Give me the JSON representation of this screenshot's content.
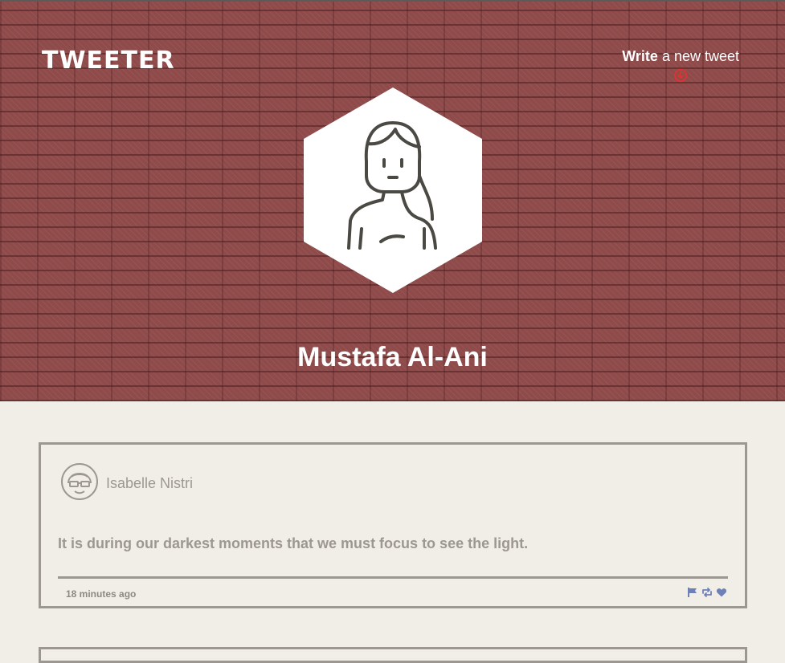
{
  "header": {
    "logo": "TWEETER",
    "compose": {
      "strong": "Write",
      "rest": " a new tweet",
      "icon": "arrow-down-circle-icon",
      "icon_color": "#e0332f"
    },
    "profile": {
      "name": "Mustafa Al-Ani",
      "avatar_icon": "person-avatar-icon"
    },
    "background_color": "#8f4a4a"
  },
  "feed": {
    "tweets": [
      {
        "author": "Isabelle Nistri",
        "avatar_icon": "person-with-glasses-avatar-icon",
        "text": "It is during our darkest moments that we must focus to see the light.",
        "time": "18 minutes ago",
        "actions": [
          "flag-icon",
          "retweet-icon",
          "heart-icon"
        ],
        "action_color": "#6f7fb8"
      }
    ]
  }
}
